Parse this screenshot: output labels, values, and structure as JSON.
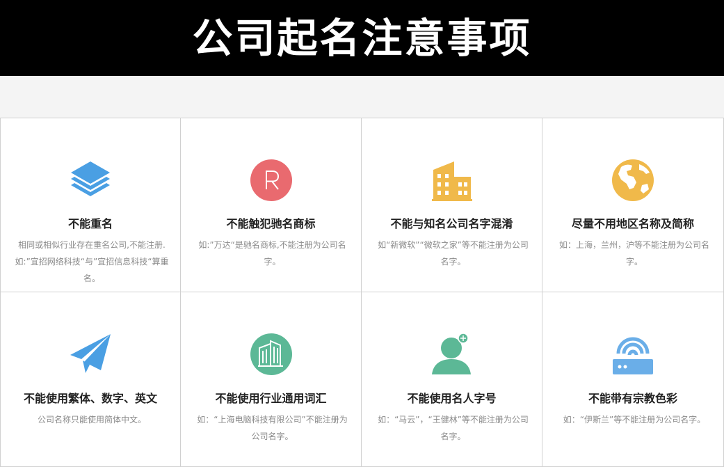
{
  "header": {
    "title": "公司起名注意事项"
  },
  "cards": [
    {
      "icon": "layers-icon",
      "color": "#4a9fe3",
      "title": "不能重名",
      "desc": "相同或相似行业存在重名公司,不能注册.如:”宜招网络科技“与”宜招信息科技“算重名。"
    },
    {
      "icon": "registered-trademark-icon",
      "color": "#e96a6f",
      "title": "不能触犯驰名商标",
      "desc": "如:”万达“是驰名商标,不能注册为公司名字。"
    },
    {
      "icon": "buildings-icon",
      "color": "#f0b94a",
      "title": "不能与知名公司名字混淆",
      "desc": "如“新微软”“微软之家”等不能注册为公司名字。"
    },
    {
      "icon": "globe-icon",
      "color": "#f0b94a",
      "title": "尽量不用地区名称及简称",
      "desc": "如：上海，兰州，沪等不能注册为公司名字。"
    },
    {
      "icon": "paper-plane-icon",
      "color": "#4a9fe3",
      "title": "不能使用繁体、数字、英文",
      "desc": "公司名称只能使用简体中文。"
    },
    {
      "icon": "office-building-icon",
      "color": "#5cb896",
      "title": "不能使用行业通用词汇",
      "desc": "如：“上海电脑科技有限公司”不能注册为公司名字。"
    },
    {
      "icon": "add-user-icon",
      "color": "#5cb896",
      "title": "不能使用名人字号",
      "desc": "如：“马云”，“王健林”等不能注册为公司名字。"
    },
    {
      "icon": "wifi-router-icon",
      "color": "#6aaee8",
      "title": "不能带有宗教色彩",
      "desc": "如：“伊斯兰”等不能注册为公司名字。"
    }
  ]
}
